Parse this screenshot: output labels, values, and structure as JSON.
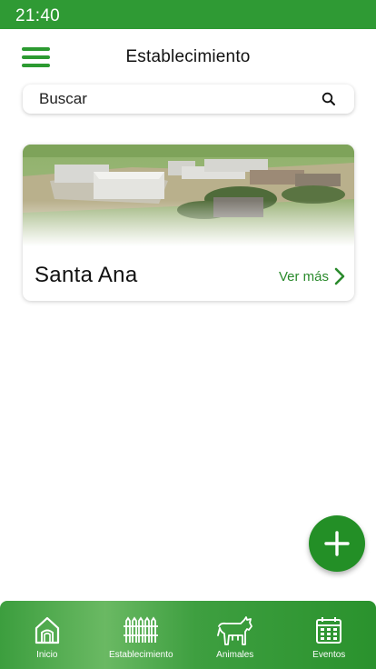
{
  "status_bar": {
    "time": "21:40"
  },
  "header": {
    "title": "Establecimiento",
    "menu_icon": "hamburger-menu-icon"
  },
  "search": {
    "placeholder": "Buscar",
    "value": "",
    "icon": "search-icon"
  },
  "establishments": [
    {
      "name": "Santa Ana",
      "link_label": "Ver más",
      "image": "farm-aerial-photo"
    }
  ],
  "fab": {
    "icon": "plus-icon"
  },
  "bottom_nav": {
    "items": [
      {
        "label": "Inicio",
        "icon": "home-icon"
      },
      {
        "label": "Establecimiento",
        "icon": "fence-icon"
      },
      {
        "label": "Animales",
        "icon": "cow-icon"
      },
      {
        "label": "Eventos",
        "icon": "calendar-icon"
      }
    ]
  },
  "colors": {
    "primary": "#2f9a34",
    "accent_dark": "#238f26",
    "link": "#2a8a2c"
  }
}
